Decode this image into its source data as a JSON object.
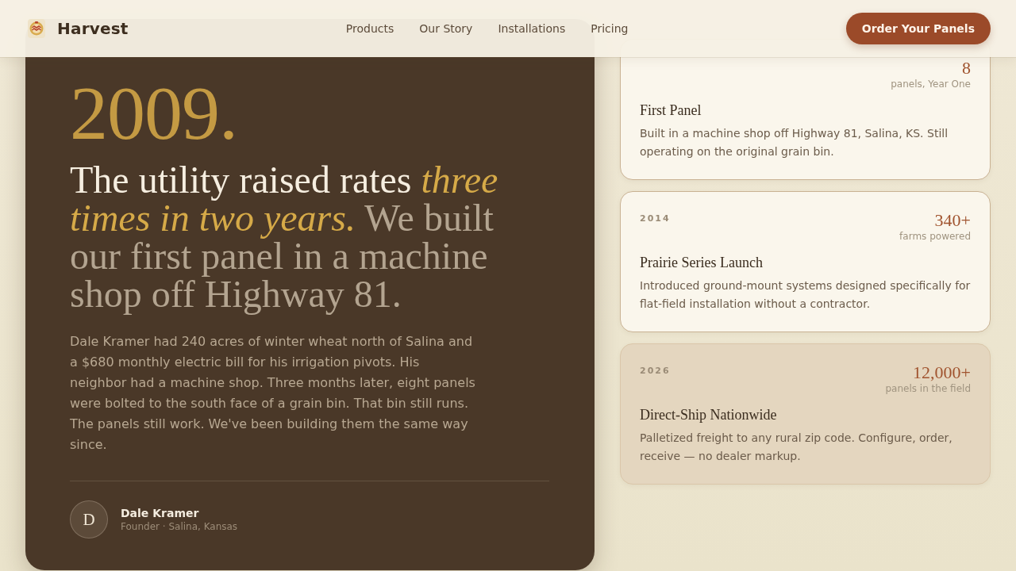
{
  "header": {
    "brand": "Harvest",
    "nav": [
      "Products",
      "Our Story",
      "Installations",
      "Pricing"
    ],
    "cta": "Order Your Panels"
  },
  "story": {
    "year": "2009.",
    "headline": [
      {
        "kind": "lead",
        "text": "The utility raised rates "
      },
      {
        "kind": "emphasis",
        "text": "three times in two years."
      },
      {
        "kind": "muted",
        "text": " We built our first panel in a machine shop off Highway 81."
      }
    ],
    "body": "Dale Kramer had 240 acres of winter wheat north of Salina and a $680 monthly electric bill for his irrigation pivots. His neighbor had a machine shop. Three months later, eight panels were bolted to the south face of a grain bin. That bin still runs. The panels still work. We've been building them the same way since.",
    "author": {
      "initial": "D",
      "name": "Dale Kramer",
      "role": "Founder · Salina, Kansas"
    }
  },
  "milestones": [
    {
      "stat": "8",
      "stat_label": "panels, Year One",
      "title": "First Panel",
      "description": "Built in a machine shop off Highway 81, Salina, KS. Still operating on the original grain bin.",
      "highlighted": false
    },
    {
      "year": "2014",
      "stat": "340+",
      "stat_label": "farms powered",
      "title": "Prairie Series Launch",
      "description": "Introduced ground-mount systems designed specifically for flat-field installation without a contractor.",
      "highlighted": false
    },
    {
      "year": "2026",
      "stat": "12,000+",
      "stat_label": "panels in the field",
      "title": "Direct-Ship Nationwide",
      "description": "Palletized freight to any rural zip code. Configure, order, receive — no dealer markup.",
      "highlighted": true
    }
  ]
}
